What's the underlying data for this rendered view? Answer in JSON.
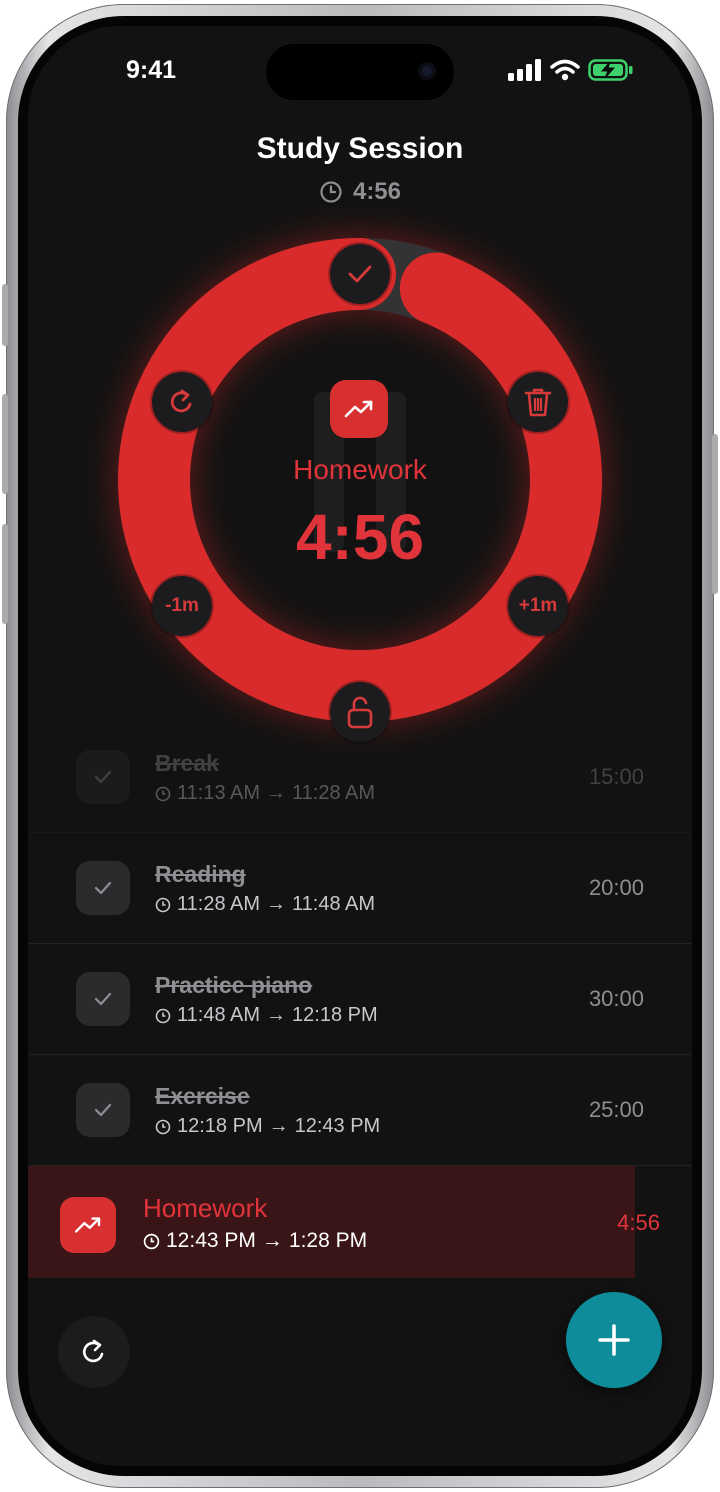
{
  "status_bar": {
    "time": "9:41"
  },
  "header": {
    "title": "Study Session",
    "elapsed": "4:56"
  },
  "timer": {
    "label": "Homework",
    "time": "4:56",
    "remaining_fraction": 0.94,
    "accent_color": "#d92b2b",
    "controls": {
      "minus": "-1m",
      "plus": "+1m"
    }
  },
  "tasks": [
    {
      "name": "Break",
      "start": "11:13 AM",
      "end": "11:28 AM",
      "duration": "15:00",
      "done": true
    },
    {
      "name": "Reading",
      "start": "11:28 AM",
      "end": "11:48 AM",
      "duration": "20:00",
      "done": true
    },
    {
      "name": "Practice piano",
      "start": "11:48 AM",
      "end": "12:18 PM",
      "duration": "30:00",
      "done": true
    },
    {
      "name": "Exercise",
      "start": "12:18 PM",
      "end": "12:43 PM",
      "duration": "25:00",
      "done": true
    }
  ],
  "current_task": {
    "name": "Homework",
    "start": "12:43 PM",
    "end": "1:28 PM",
    "duration": "4:56"
  },
  "colors": {
    "accent": "#d92b2b",
    "fab": "#0f8c99",
    "background": "#121212"
  },
  "icons": [
    "clock-icon",
    "check-icon",
    "trash-icon",
    "refresh-icon",
    "lock-open-icon",
    "trend-up-icon",
    "plus-icon"
  ]
}
